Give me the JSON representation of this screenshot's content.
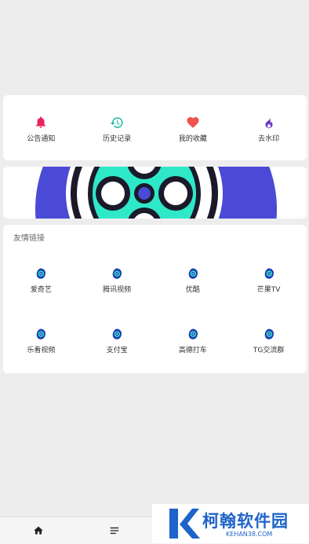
{
  "quick_actions": [
    {
      "label": "公告通知",
      "icon": "bell-icon",
      "color": "#e8245a"
    },
    {
      "label": "历史记录",
      "icon": "history-icon",
      "color": "#1fb7a6"
    },
    {
      "label": "我的收藏",
      "icon": "heart-icon",
      "color": "#ef5350"
    },
    {
      "label": "去水印",
      "icon": "flame-icon",
      "color": "#6a35c7"
    }
  ],
  "banner": {
    "colors": {
      "primary": "#4a4ad6",
      "accent": "#2ee8c8"
    }
  },
  "friend_links": {
    "title": "友情链接",
    "items": [
      {
        "label": "爱奇艺"
      },
      {
        "label": "腾讯视频"
      },
      {
        "label": "优酷"
      },
      {
        "label": "芒果TV"
      },
      {
        "label": "乐看视频"
      },
      {
        "label": "支付宝"
      },
      {
        "label": "高德打车"
      },
      {
        "label": "TG交流群"
      }
    ]
  },
  "bottom_nav": [
    {
      "icon": "home-icon"
    },
    {
      "icon": "menu-icon"
    }
  ],
  "watermark": {
    "title": "柯翰软件园",
    "subtitle": "KEHAN38.COM"
  }
}
